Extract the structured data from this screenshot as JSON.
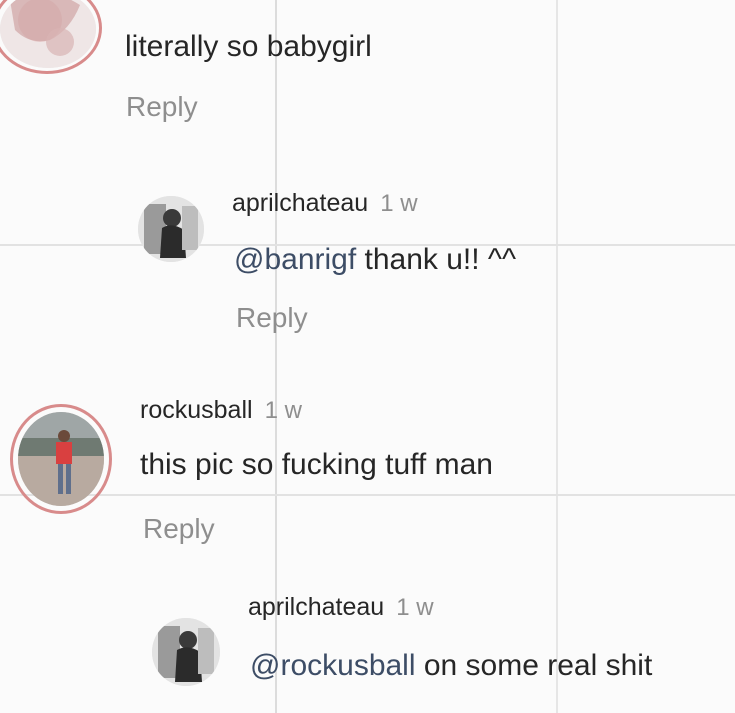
{
  "comments": [
    {
      "text": "literally so babygirl",
      "reply_label": "Reply"
    },
    {
      "username": "aprilchateau",
      "time": "1 w",
      "mention": "@banrigf",
      "text": " thank u!! ^^",
      "reply_label": "Reply"
    },
    {
      "username": "rockusball",
      "time": "1 w",
      "text": "this pic so fucking tuff man",
      "reply_label": "Reply"
    },
    {
      "username": "aprilchateau",
      "time": "1 w",
      "mention": "@rockusball",
      "text": " on some real shit"
    }
  ],
  "colors": {
    "ring": "#d88b8b",
    "mention": "#3d4d66",
    "muted": "#8e8e8e"
  }
}
